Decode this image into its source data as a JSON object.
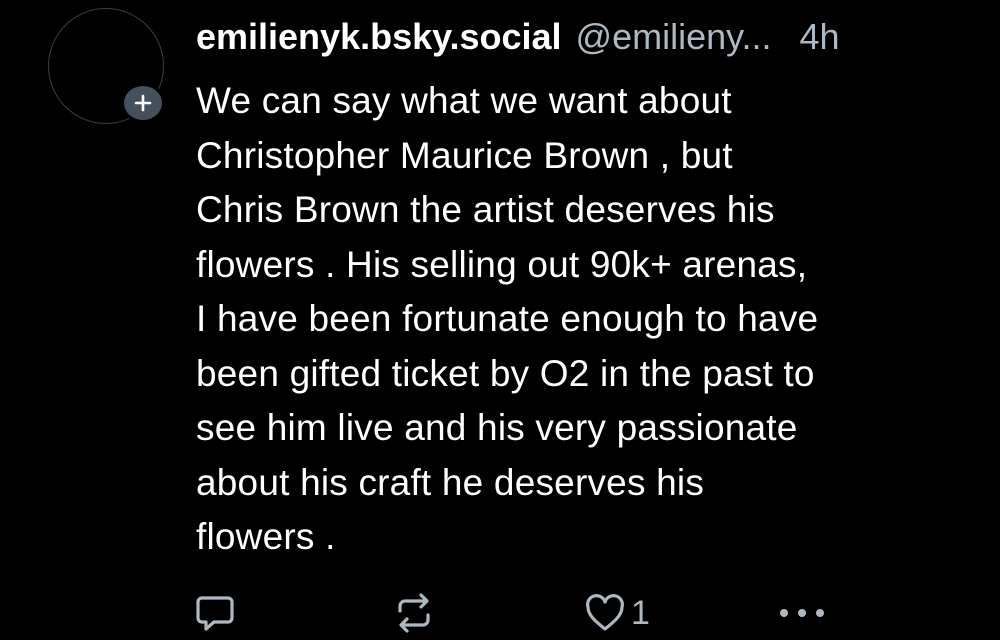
{
  "post": {
    "author": {
      "display_name": "emilienyk.bsky.social",
      "handle": "@emilieny..."
    },
    "timestamp": "4h",
    "text": "We can say what we want about\nChristopher Maurice Brown , but\nChris Brown the artist deserves his\nflowers . His selling out 90k+ arenas,\nI have been fortunate enough to have\nbeen gifted ticket by O2 in the past to\nsee him live and his very passionate\nabout his craft he deserves his\nflowers .",
    "actions": {
      "like_count": "1"
    }
  },
  "icons": {
    "follow": "plus-icon",
    "reply": "reply-icon",
    "repost": "repost-icon",
    "like": "heart-icon",
    "more": "more-dots-icon"
  },
  "colors": {
    "background": "#000000",
    "text": "#ffffff",
    "muted": "#aeb8c3",
    "follow_badge": "#44505c"
  }
}
